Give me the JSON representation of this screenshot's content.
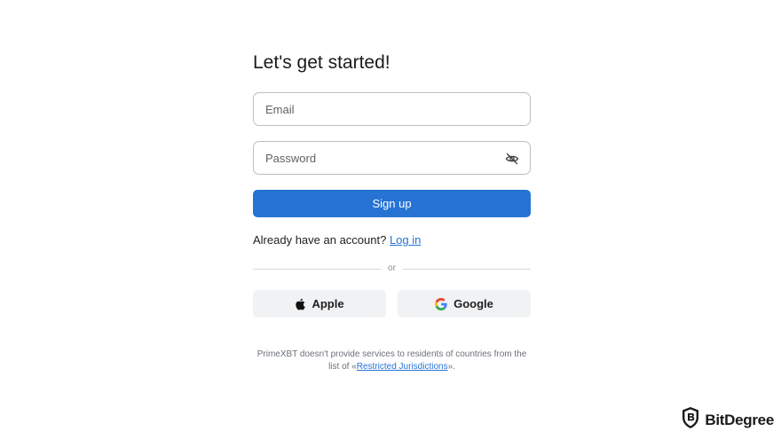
{
  "form": {
    "title": "Let's get started!",
    "email": {
      "placeholder": "Email",
      "value": ""
    },
    "password": {
      "placeholder": "Password",
      "value": "",
      "visibility_icon": "eye-off-icon"
    },
    "signup_label": "Sign up",
    "account_prompt": "Already have an account?",
    "login_link": "Log in",
    "divider_text": "or",
    "social": {
      "apple": {
        "label": "Apple",
        "icon": "apple-icon"
      },
      "google": {
        "label": "Google",
        "icon": "google-icon"
      }
    },
    "notice": {
      "text_before": "PrimeXBT doesn't provide services to residents of countries from the list of «",
      "link": "Restricted Jurisdictions",
      "text_after": "»."
    }
  },
  "watermark": {
    "text": "BitDegree",
    "icon": "bitdegree-shield-icon"
  },
  "colors": {
    "primary": "#2673d4",
    "input_border": "#b9bec6",
    "social_bg": "#f1f2f4",
    "divider": "#d5d8dc"
  }
}
